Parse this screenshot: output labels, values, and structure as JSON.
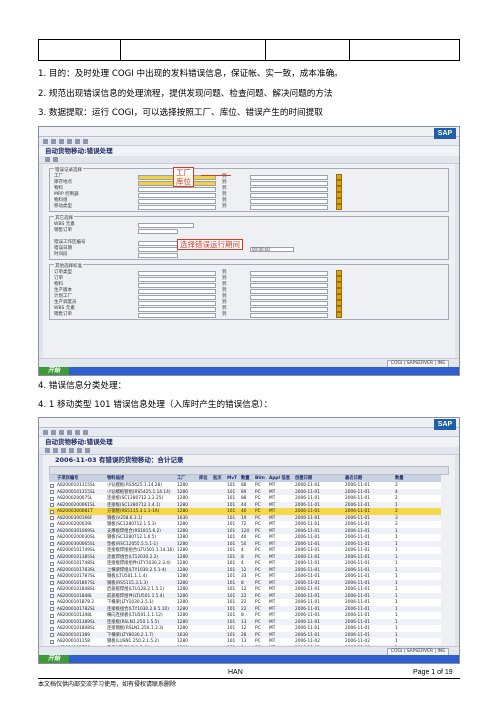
{
  "paragraphs": {
    "p1": "1. 目的：及时处理 COGI 中出现的发料错误信息，保证帐、实一致，成本准确。",
    "p2": "2. 规范出现错误信息的处理流程，提供发现问题、检查问题、解决问题的方法",
    "p3": "3. 数据提取：运行 COGI，可以选择按照工厂、库位、错误产生的时间提取",
    "p4": "4. 错误信息分类处理：",
    "p5": "4. 1 移动类型 101 错误信息处理（入库时产生的错误信息）："
  },
  "screen1": {
    "title": "自动货物移动:错误处理",
    "logo": "SAP",
    "group1_title": "错误记录选择",
    "fields1": [
      "工厂",
      "库存地点",
      "物料",
      "MRP 控制器",
      "物料组",
      "移动类型"
    ],
    "group2_title": "其它选择",
    "fields2": [
      "WBS 元素",
      "销售订单",
      "",
      "错误工作区编号",
      "错误日期",
      "时间段"
    ],
    "to_label": "到",
    "date_value": "00:00:00",
    "group3_title": "其他选择标准",
    "fields3": [
      "订单类型",
      "订单",
      "物料",
      "生产版本",
      "计划工厂",
      "生产调度员",
      "WBS 元素",
      "销售订单"
    ],
    "annot_plant": "工厂",
    "annot_storage": "库位",
    "annot_period": "选择错误运行期间",
    "status": "COGI | SAPSERVER | INS"
  },
  "screen2": {
    "title": "自动货物移动:错误处理",
    "logo": "SAP",
    "table_title": "2006-11-03 有错误的货物移动：合计记录",
    "headers": [
      "子项目编号",
      "物料描述",
      "工厂",
      "库位",
      "批次",
      "MvT",
      "数量",
      "BUn",
      "Appl 信息",
      "创建日期",
      "最近日期",
      "数量"
    ],
    "rows": [
      [
        "A82000101315SL",
        "小钻模板(RS5425.1.14.28)",
        "1280",
        "",
        "",
        "101",
        "88",
        "PC",
        "MT",
        "2006-11-01",
        "2006-11-01",
        "2"
      ],
      [
        "A82000101315SL",
        "小钻模板管组(RS5425.1.14.14)",
        "1280",
        "",
        "",
        "101",
        "89",
        "PC",
        "MT",
        "2006-11-01",
        "2006-11-01",
        "4"
      ],
      [
        "A82000200075L",
        "连接板(SC1280712.1.2.25)",
        "1280",
        "",
        "",
        "101",
        "88",
        "PC",
        "MT",
        "2006-11-01",
        "2006-11-01",
        "2"
      ],
      [
        "A82000200061SL",
        "连接板(SC1280712.1.4.1)",
        "1280",
        "",
        "",
        "101",
        "44",
        "PC",
        "MT",
        "2006-11-01",
        "2006-11-01",
        "1"
      ],
      [
        "A82000300081T",
        "方钢管(RS5115.3.1.1-1A)",
        "1280",
        "",
        "",
        "101",
        "40",
        "PC",
        "MT",
        "2006-11-01",
        "2006-11-01",
        "2"
      ],
      [
        "A82000300166F",
        "钢板(V258.6.3.1)",
        "1630",
        "",
        "",
        "101",
        "19",
        "PC",
        "MT",
        "2006-11-01",
        "2006-11-01",
        "3"
      ],
      [
        "A82000200039L",
        "钢板(SC1280712.1.5.3)",
        "1280",
        "",
        "",
        "101",
        "72",
        "PC",
        "MT",
        "2006-11-01",
        "2006-11-01",
        "2"
      ],
      [
        "A82000301069SL",
        "支撑板焊组合(RS1815.6.2)",
        "1280",
        "",
        "",
        "101",
        "120",
        "PC",
        "MT",
        "2006-11-01",
        "2006-11-01",
        "1"
      ],
      [
        "A82000200030SL",
        "钢板(SC1280712.1.6.5)",
        "1280",
        "",
        "",
        "101",
        "40",
        "PC",
        "MT",
        "2006-11-01",
        "2006-11-01",
        "1"
      ],
      [
        "A82000300065SL",
        "垫板(RSC12055.5.5.1-1)",
        "1280",
        "",
        "",
        "101",
        "50",
        "PC",
        "MT",
        "2006-11-01",
        "2006-11-01",
        "1"
      ],
      [
        "A82000101749SL",
        "连接板焊接组合(LTU501.1.14.16)",
        "1280",
        "",
        "",
        "101",
        "4",
        "PC",
        "MT",
        "2006-11-01",
        "2006-11-01",
        "1"
      ],
      [
        "A82000101385SL",
        "走板焊组合(LT12030.2.2)",
        "1280",
        "",
        "",
        "101",
        "8",
        "PC",
        "MT",
        "2006-11-01",
        "2006-11-01",
        "1"
      ],
      [
        "A82000101748SL",
        "连接板焊接组件(LTY1030.2.3.4)",
        "1280",
        "",
        "",
        "101",
        "4",
        "PC",
        "MT",
        "2006-11-01",
        "2006-11-01",
        "1"
      ],
      [
        "A82000101783SL",
        "上横梁焊组(LTY1030.2.5.1-4)",
        "1280",
        "",
        "",
        "101",
        "12",
        "PC",
        "MT",
        "2006-11-01",
        "2006-11-01",
        "1"
      ],
      [
        "A82000101787SL",
        "钢板(LTU501.1.1.4)",
        "1280",
        "",
        "",
        "101",
        "33",
        "PC",
        "MT",
        "2006-11-01",
        "2006-11-01",
        "1"
      ],
      [
        "A82000101867SL",
        "钢板(RS5115.3.1.3)",
        "1280",
        "",
        "",
        "101",
        "8",
        "PC",
        "MT",
        "2006-11-01",
        "2006-11-01",
        "1"
      ],
      [
        "A82000101848SL",
        "后盖板焊组(LTU128.2.1.5.1)",
        "1280",
        "",
        "",
        "101",
        "12",
        "PC",
        "MT",
        "2006-11-01",
        "2006-11-01",
        "1"
      ],
      [
        "A82000101848L",
        "前盖板焊组件(LTU501.1.5.4)",
        "1280",
        "",
        "",
        "101",
        "22",
        "PC",
        "MT",
        "2006-11-01",
        "2006-11-01",
        "1"
      ],
      [
        "A82000101878.2",
        "下横梁(LTY1030.2.5.1)",
        "1280",
        "",
        "",
        "101",
        "22",
        "PC",
        "MT",
        "2006-11-01",
        "2006-11-01",
        "1"
      ],
      [
        "A82000101782SL",
        "连接板组合(LTY1030.2.6.5.10)",
        "1280",
        "",
        "",
        "101",
        "22",
        "PC",
        "MT",
        "2006-11-01",
        "2006-11-01",
        "1"
      ],
      [
        "A82000101348L",
        "横向连接板(LTU501.1.1.12)",
        "1280",
        "",
        "",
        "101",
        "8",
        "PC",
        "MT",
        "2006-11-01",
        "2006-11-01",
        "1"
      ],
      [
        "A82000101389SL",
        "连接板(RSLN1.250.1.5.5)",
        "1280",
        "",
        "",
        "101",
        "13",
        "PC",
        "MT",
        "2006-11-01",
        "2006-11-01",
        "1"
      ],
      [
        "A82000101808SL",
        "连接钢板(RSLN1.250.1.3.3)",
        "1280",
        "",
        "",
        "101",
        "12",
        "PC",
        "MT",
        "2006-11-01",
        "2006-11-01",
        "1"
      ],
      [
        "A82000101389",
        "下横梁(LTY8030.2.1.7)",
        "1630",
        "",
        "",
        "101",
        "28",
        "PC",
        "MT",
        "2006-11-01",
        "2006-11-01",
        "1"
      ],
      [
        "A82000101158",
        "钢板(LUSN1.250.2.1.5.2)",
        "1280",
        "",
        "",
        "101",
        "13",
        "PC",
        "MT",
        "2006-11-02",
        "2006-11-02",
        "1"
      ],
      [
        "A82000101750",
        "垫板(LTU50.1.1.2.4)",
        "1280",
        "",
        "",
        "101",
        "8",
        "PC",
        "MT",
        "2006-11-02",
        "2006-11-02",
        "1"
      ]
    ],
    "status": "COGI | SAPSERVER | INS"
  },
  "taskbar": {
    "start": "开始"
  },
  "footer": {
    "han": "HAN",
    "page": "Page 1 of 19",
    "note": "本文档仅供内部交流学习使用，如有侵权请联系删除"
  },
  "colors": {
    "annotation": "#d23b28",
    "sap_blue": "#1d5fa8",
    "highlight": "#f3d13c",
    "taskbar": "#2f5fcf"
  }
}
